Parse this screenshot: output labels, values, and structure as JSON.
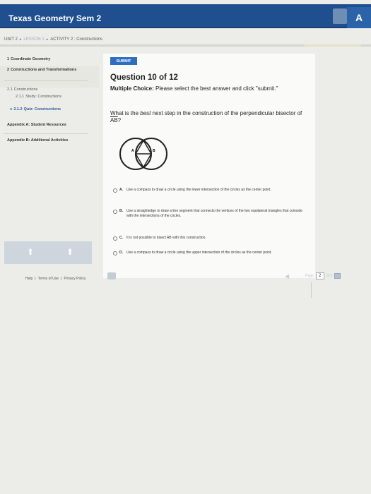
{
  "header": {
    "course_title": "Texas Geometry Sem 2",
    "brand_text": "A"
  },
  "breadcrumb": {
    "unit": "UNIT 2",
    "lesson": "LESSON 1",
    "activity": "ACTIVITY 2 : Constructions",
    "separator": "▸"
  },
  "sidebar": {
    "items": [
      {
        "number": "1",
        "label": "Coordinate Geometry"
      },
      {
        "number": "2",
        "label": "Constructions and Transformations"
      },
      {
        "number": "2.1",
        "label": "Constructions"
      },
      {
        "number": "2.1.1",
        "label": "Study: Constructions"
      },
      {
        "number": "2.1.2",
        "label": "Quiz: Constructions"
      },
      {
        "number": "",
        "label": "Appendix A: Student Resources"
      },
      {
        "number": "",
        "label": "Appendix B: Additional Activities"
      }
    ],
    "footer_links": [
      "Help",
      "Terms of Use",
      "Privacy Policy"
    ],
    "footer_separator": "|"
  },
  "content": {
    "submit_label": "SUBMIT",
    "question_header": "Question 10 of 12",
    "instructions_bold": "Multiple Choice:",
    "instructions_rest": " Please select the best answer and click \"submit.\"",
    "question_prefix": "What is the ",
    "question_emph": "best",
    "question_suffix": " next step in the construction of the perpendicular bisector of ",
    "question_segment": "AB",
    "question_end": "?",
    "figure_labels": {
      "a": "A",
      "b": "B"
    },
    "choices": [
      {
        "letter": "A.",
        "text": "Use a compass to draw a circle using the lower intersection of the circles as the center point."
      },
      {
        "letter": "B.",
        "text": "Use a straightedge to draw a line segment that connects the vertices of the two equilateral triangles that coincide with the intersections of the circles."
      },
      {
        "letter": "C.",
        "text": "It is not possible to bisect AB with this construction."
      },
      {
        "letter": "D.",
        "text": "Use a compass to draw a circle using the upper intersection of the circles as the center point."
      }
    ]
  },
  "pager": {
    "label": "Page",
    "current": "2",
    "total_text": "of 2"
  },
  "colors": {
    "header_blue": "#1f4f8f",
    "submit_blue": "#2c6fc0",
    "sidebar_link_blue": "#2b5c98"
  }
}
